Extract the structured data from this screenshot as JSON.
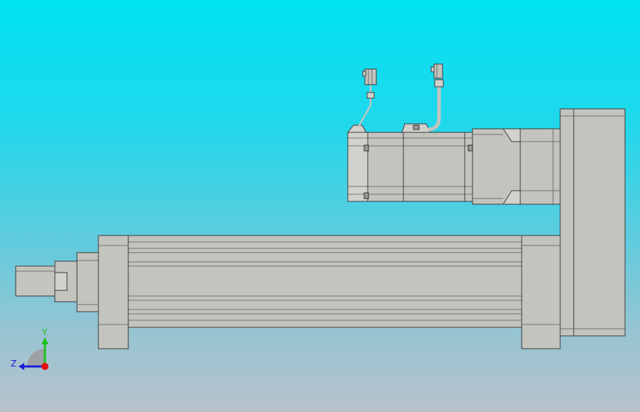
{
  "triad": {
    "y_label": "Y",
    "z_label": "Z",
    "y_color": "#1fbf1f",
    "z_color": "#1c1cd6",
    "x_color": "#e01010"
  },
  "background": {
    "top_color": "#00e3f2",
    "bottom_color": "#b8c2cc"
  },
  "model": {
    "part_color": "#c4c4bf",
    "edge_color": "#3a3a3a"
  }
}
